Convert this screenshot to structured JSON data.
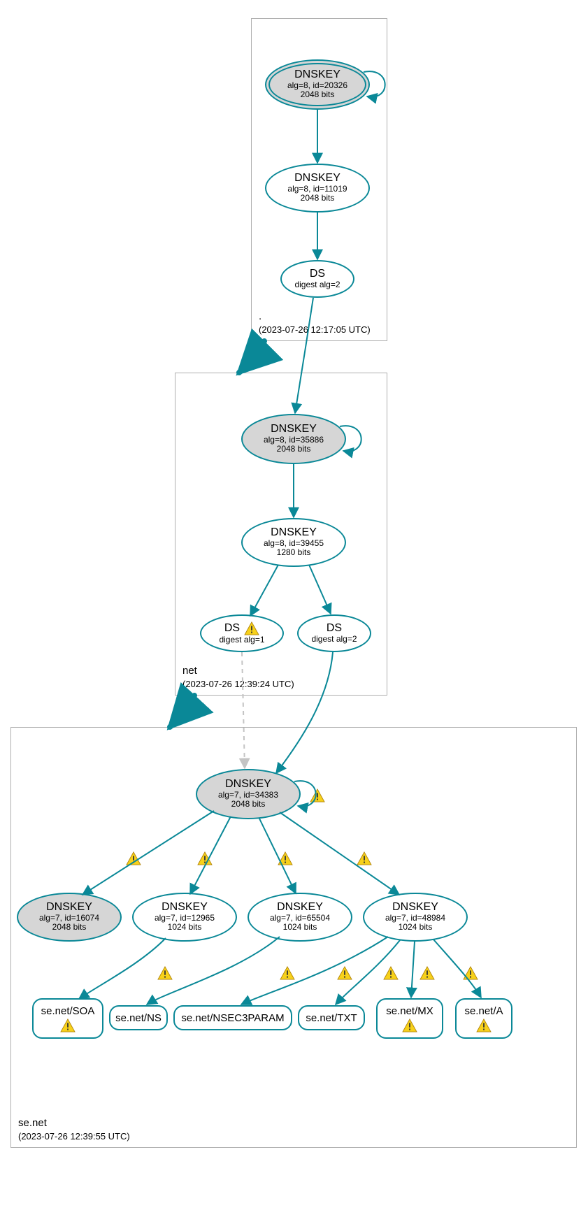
{
  "zones": {
    "root": {
      "name": ".",
      "timestamp": "(2023-07-26 12:17:05 UTC)"
    },
    "net": {
      "name": "net",
      "timestamp": "(2023-07-26 12:39:24 UTC)"
    },
    "senet": {
      "name": "se.net",
      "timestamp": "(2023-07-26 12:39:55 UTC)"
    }
  },
  "nodes": {
    "root_ksk": {
      "title": "DNSKEY",
      "line1": "alg=8, id=20326",
      "line2": "2048 bits"
    },
    "root_zsk": {
      "title": "DNSKEY",
      "line1": "alg=8, id=11019",
      "line2": "2048 bits"
    },
    "root_ds": {
      "title": "DS",
      "line1": "digest alg=2"
    },
    "net_ksk": {
      "title": "DNSKEY",
      "line1": "alg=8, id=35886",
      "line2": "2048 bits"
    },
    "net_zsk": {
      "title": "DNSKEY",
      "line1": "alg=8, id=39455",
      "line2": "1280 bits"
    },
    "net_ds1": {
      "title": "DS",
      "line1": "digest alg=1"
    },
    "net_ds2": {
      "title": "DS",
      "line1": "digest alg=2"
    },
    "senet_ksk": {
      "title": "DNSKEY",
      "line1": "alg=7, id=34383",
      "line2": "2048 bits"
    },
    "senet_k16074": {
      "title": "DNSKEY",
      "line1": "alg=7, id=16074",
      "line2": "2048 bits"
    },
    "senet_k12965": {
      "title": "DNSKEY",
      "line1": "alg=7, id=12965",
      "line2": "1024 bits"
    },
    "senet_k65504": {
      "title": "DNSKEY",
      "line1": "alg=7, id=65504",
      "line2": "1024 bits"
    },
    "senet_k48984": {
      "title": "DNSKEY",
      "line1": "alg=7, id=48984",
      "line2": "1024 bits"
    }
  },
  "rr": {
    "soa": "se.net/SOA",
    "ns": "se.net/NS",
    "nsec3param": "se.net/NSEC3PARAM",
    "txt": "se.net/TXT",
    "mx": "se.net/MX",
    "a": "se.net/A"
  }
}
